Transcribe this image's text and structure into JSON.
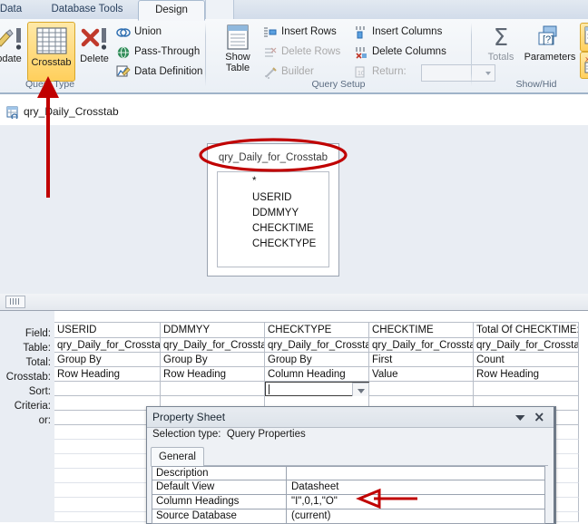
{
  "ribbon": {
    "tabs": [
      {
        "label": "Data",
        "active": false
      },
      {
        "label": "Database Tools",
        "active": false
      },
      {
        "label": "Design",
        "active": true
      }
    ],
    "groups": [
      {
        "name": "query-type",
        "label": "Query Type"
      },
      {
        "name": "query-setup",
        "label": "Query Setup"
      },
      {
        "name": "show-hide",
        "label": "Show/Hid"
      }
    ],
    "query_type": {
      "update_label": "pdate",
      "crosstab_label": "Crosstab",
      "delete_label": "Delete",
      "union_label": "Union",
      "pass_through_label": "Pass-Through",
      "data_definition_label": "Data Definition",
      "selected": "Crosstab"
    },
    "query_setup": {
      "show_table_label_line1": "Show",
      "show_table_label_line2": "Table",
      "insert_rows_label": "Insert Rows",
      "delete_rows_label": "Delete Rows",
      "builder_label": "Builder",
      "insert_columns_label": "Insert Columns",
      "delete_columns_label": "Delete Columns",
      "return_label": "Return:",
      "return_value": ""
    },
    "show_hide": {
      "totals_label": "Totals",
      "parameters_label": "Parameters"
    }
  },
  "document_tab": {
    "label": "qry_Daily_Crosstab"
  },
  "canvas": {
    "table": {
      "title": "qry_Daily_for_Crosstab",
      "fields": [
        "*",
        "USERID",
        "DDMMYY",
        "CHECKTIME",
        "CHECKTYPE"
      ]
    }
  },
  "design_grid": {
    "row_labels": [
      "Field:",
      "Table:",
      "Total:",
      "Crosstab:",
      "Sort:",
      "Criteria:",
      "or:"
    ],
    "columns": [
      {
        "field": "USERID",
        "table": "qry_Daily_for_Crossta",
        "total": "Group By",
        "crosstab": "Row Heading",
        "sort": "",
        "criteria": "",
        "or": ""
      },
      {
        "field": "DDMMYY",
        "table": "qry_Daily_for_Crossta",
        "total": "Group By",
        "crosstab": "Row Heading",
        "sort": "",
        "criteria": "",
        "or": ""
      },
      {
        "field": "CHECKTYPE",
        "table": "qry_Daily_for_Crossta",
        "total": "Group By",
        "crosstab": "Column Heading",
        "sort": "",
        "criteria": "",
        "or": ""
      },
      {
        "field": "CHECKTIME",
        "table": "qry_Daily_for_Crossta",
        "total": "First",
        "crosstab": "Value",
        "sort": "",
        "criteria": "",
        "or": ""
      },
      {
        "field": "Total Of CHECKTIME: ",
        "table": "qry_Daily_for_Crossta",
        "total": "Count",
        "crosstab": "Row Heading",
        "sort": "",
        "criteria": "",
        "or": ""
      }
    ]
  },
  "property_sheet": {
    "title": "Property Sheet",
    "selection_type_label": "Selection type:",
    "selection_type_value": "Query Properties",
    "tab_general": "General",
    "properties": [
      {
        "name": "Description",
        "value": ""
      },
      {
        "name": "Default View",
        "value": "Datasheet"
      },
      {
        "name": "Column Headings",
        "value": "\"I\",0,1,\"O\""
      },
      {
        "name": "Source Database",
        "value": "(current)"
      }
    ]
  },
  "annotations": {
    "arrow_to_crosstab": "red-up-arrow",
    "ellipse_table_title": "red-ellipse",
    "arrow_to_column_headings": "red-left-arrow",
    "color": "#c00000"
  },
  "colors": {
    "accent_selected": "#ffcf5c",
    "canvas_bg": "#e9edf3",
    "annotation_red": "#c00000"
  }
}
